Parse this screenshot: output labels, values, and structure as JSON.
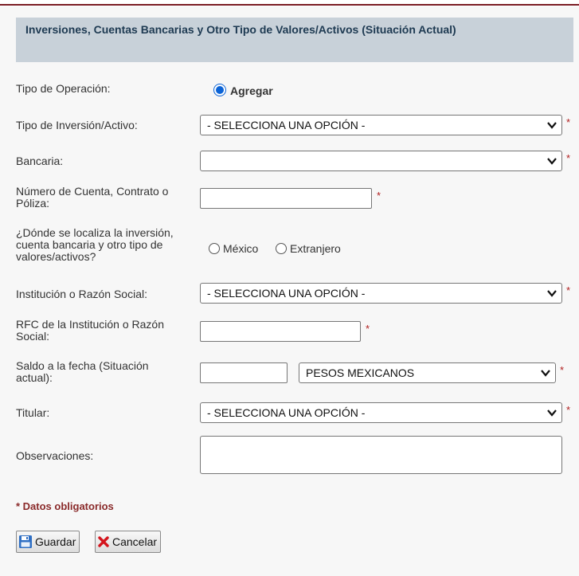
{
  "header": {
    "title": "Inversiones, Cuentas Bancarias y Otro Tipo de Valores/Activos (Situación Actual)"
  },
  "form": {
    "tipo_operacion": {
      "label": "Tipo de Operación:",
      "option": "Agregar"
    },
    "tipo_inversion": {
      "label": "Tipo de Inversión/Activo:",
      "value": "- SELECCIONA UNA OPCIÓN -"
    },
    "bancaria": {
      "label": "Bancaria:",
      "value": ""
    },
    "numero_cuenta": {
      "label_line1": "Número de Cuenta, Contrato o",
      "label_line2": "Póliza:",
      "value": ""
    },
    "ubicacion": {
      "label_line1": "¿Dónde se localiza la inversión,",
      "label_line2": "cuenta bancaria y otro tipo de",
      "label_line3": "valores/activos?",
      "option1": "México",
      "option2": "Extranjero"
    },
    "institucion": {
      "label": "Institución o Razón Social:",
      "value": "- SELECCIONA UNA OPCIÓN -"
    },
    "rfc": {
      "label_line1": "RFC de la Institución o Razón",
      "label_line2": "Social:",
      "value": ""
    },
    "saldo": {
      "label_line1": "Saldo a la fecha (Situación",
      "label_line2": "actual):",
      "value": "",
      "currency": "PESOS MEXICANOS"
    },
    "titular": {
      "label": "Titular:",
      "value": "- SELECCIONA UNA OPCIÓN -"
    },
    "observaciones": {
      "label": "Observaciones:",
      "value": ""
    },
    "required_marker": "*"
  },
  "footer": {
    "required_note": "* Datos obligatorios",
    "save_label": "Guardar",
    "cancel_label": "Cancelar"
  },
  "colors": {
    "accent": "#7a1c24",
    "header_bg": "#c8d1d9",
    "radio_selected": "#0b63d6",
    "required": "#b01e1e"
  }
}
